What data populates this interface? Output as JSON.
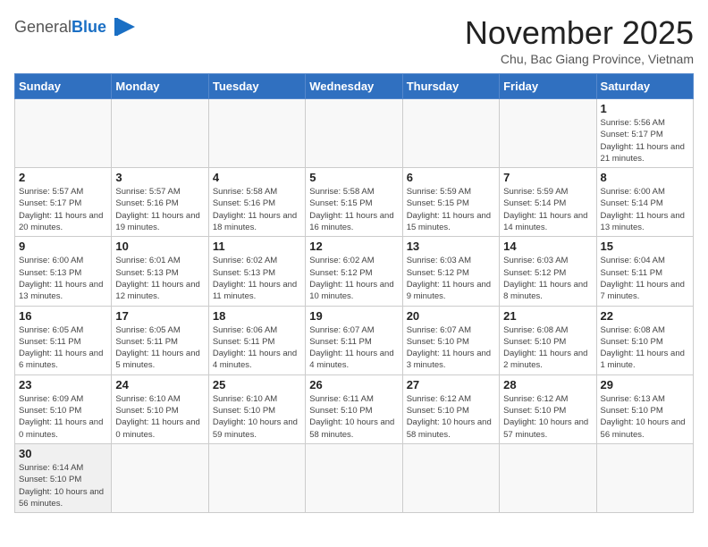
{
  "header": {
    "logo_general": "General",
    "logo_blue": "Blue",
    "month_title": "November 2025",
    "subtitle": "Chu, Bac Giang Province, Vietnam"
  },
  "weekdays": [
    "Sunday",
    "Monday",
    "Tuesday",
    "Wednesday",
    "Thursday",
    "Friday",
    "Saturday"
  ],
  "weeks": [
    [
      {
        "day": "",
        "info": ""
      },
      {
        "day": "",
        "info": ""
      },
      {
        "day": "",
        "info": ""
      },
      {
        "day": "",
        "info": ""
      },
      {
        "day": "",
        "info": ""
      },
      {
        "day": "",
        "info": ""
      },
      {
        "day": "1",
        "info": "Sunrise: 5:56 AM\nSunset: 5:17 PM\nDaylight: 11 hours and 21 minutes."
      }
    ],
    [
      {
        "day": "2",
        "info": "Sunrise: 5:57 AM\nSunset: 5:17 PM\nDaylight: 11 hours and 20 minutes."
      },
      {
        "day": "3",
        "info": "Sunrise: 5:57 AM\nSunset: 5:16 PM\nDaylight: 11 hours and 19 minutes."
      },
      {
        "day": "4",
        "info": "Sunrise: 5:58 AM\nSunset: 5:16 PM\nDaylight: 11 hours and 18 minutes."
      },
      {
        "day": "5",
        "info": "Sunrise: 5:58 AM\nSunset: 5:15 PM\nDaylight: 11 hours and 16 minutes."
      },
      {
        "day": "6",
        "info": "Sunrise: 5:59 AM\nSunset: 5:15 PM\nDaylight: 11 hours and 15 minutes."
      },
      {
        "day": "7",
        "info": "Sunrise: 5:59 AM\nSunset: 5:14 PM\nDaylight: 11 hours and 14 minutes."
      },
      {
        "day": "8",
        "info": "Sunrise: 6:00 AM\nSunset: 5:14 PM\nDaylight: 11 hours and 13 minutes."
      }
    ],
    [
      {
        "day": "9",
        "info": "Sunrise: 6:00 AM\nSunset: 5:13 PM\nDaylight: 11 hours and 13 minutes."
      },
      {
        "day": "10",
        "info": "Sunrise: 6:01 AM\nSunset: 5:13 PM\nDaylight: 11 hours and 12 minutes."
      },
      {
        "day": "11",
        "info": "Sunrise: 6:02 AM\nSunset: 5:13 PM\nDaylight: 11 hours and 11 minutes."
      },
      {
        "day": "12",
        "info": "Sunrise: 6:02 AM\nSunset: 5:12 PM\nDaylight: 11 hours and 10 minutes."
      },
      {
        "day": "13",
        "info": "Sunrise: 6:03 AM\nSunset: 5:12 PM\nDaylight: 11 hours and 9 minutes."
      },
      {
        "day": "14",
        "info": "Sunrise: 6:03 AM\nSunset: 5:12 PM\nDaylight: 11 hours and 8 minutes."
      },
      {
        "day": "15",
        "info": "Sunrise: 6:04 AM\nSunset: 5:11 PM\nDaylight: 11 hours and 7 minutes."
      }
    ],
    [
      {
        "day": "16",
        "info": "Sunrise: 6:05 AM\nSunset: 5:11 PM\nDaylight: 11 hours and 6 minutes."
      },
      {
        "day": "17",
        "info": "Sunrise: 6:05 AM\nSunset: 5:11 PM\nDaylight: 11 hours and 5 minutes."
      },
      {
        "day": "18",
        "info": "Sunrise: 6:06 AM\nSunset: 5:11 PM\nDaylight: 11 hours and 4 minutes."
      },
      {
        "day": "19",
        "info": "Sunrise: 6:07 AM\nSunset: 5:11 PM\nDaylight: 11 hours and 4 minutes."
      },
      {
        "day": "20",
        "info": "Sunrise: 6:07 AM\nSunset: 5:10 PM\nDaylight: 11 hours and 3 minutes."
      },
      {
        "day": "21",
        "info": "Sunrise: 6:08 AM\nSunset: 5:10 PM\nDaylight: 11 hours and 2 minutes."
      },
      {
        "day": "22",
        "info": "Sunrise: 6:08 AM\nSunset: 5:10 PM\nDaylight: 11 hours and 1 minute."
      }
    ],
    [
      {
        "day": "23",
        "info": "Sunrise: 6:09 AM\nSunset: 5:10 PM\nDaylight: 11 hours and 0 minutes."
      },
      {
        "day": "24",
        "info": "Sunrise: 6:10 AM\nSunset: 5:10 PM\nDaylight: 11 hours and 0 minutes."
      },
      {
        "day": "25",
        "info": "Sunrise: 6:10 AM\nSunset: 5:10 PM\nDaylight: 10 hours and 59 minutes."
      },
      {
        "day": "26",
        "info": "Sunrise: 6:11 AM\nSunset: 5:10 PM\nDaylight: 10 hours and 58 minutes."
      },
      {
        "day": "27",
        "info": "Sunrise: 6:12 AM\nSunset: 5:10 PM\nDaylight: 10 hours and 58 minutes."
      },
      {
        "day": "28",
        "info": "Sunrise: 6:12 AM\nSunset: 5:10 PM\nDaylight: 10 hours and 57 minutes."
      },
      {
        "day": "29",
        "info": "Sunrise: 6:13 AM\nSunset: 5:10 PM\nDaylight: 10 hours and 56 minutes."
      }
    ],
    [
      {
        "day": "30",
        "info": "Sunrise: 6:14 AM\nSunset: 5:10 PM\nDaylight: 10 hours and 56 minutes."
      },
      {
        "day": "",
        "info": ""
      },
      {
        "day": "",
        "info": ""
      },
      {
        "day": "",
        "info": ""
      },
      {
        "day": "",
        "info": ""
      },
      {
        "day": "",
        "info": ""
      },
      {
        "day": "",
        "info": ""
      }
    ]
  ]
}
